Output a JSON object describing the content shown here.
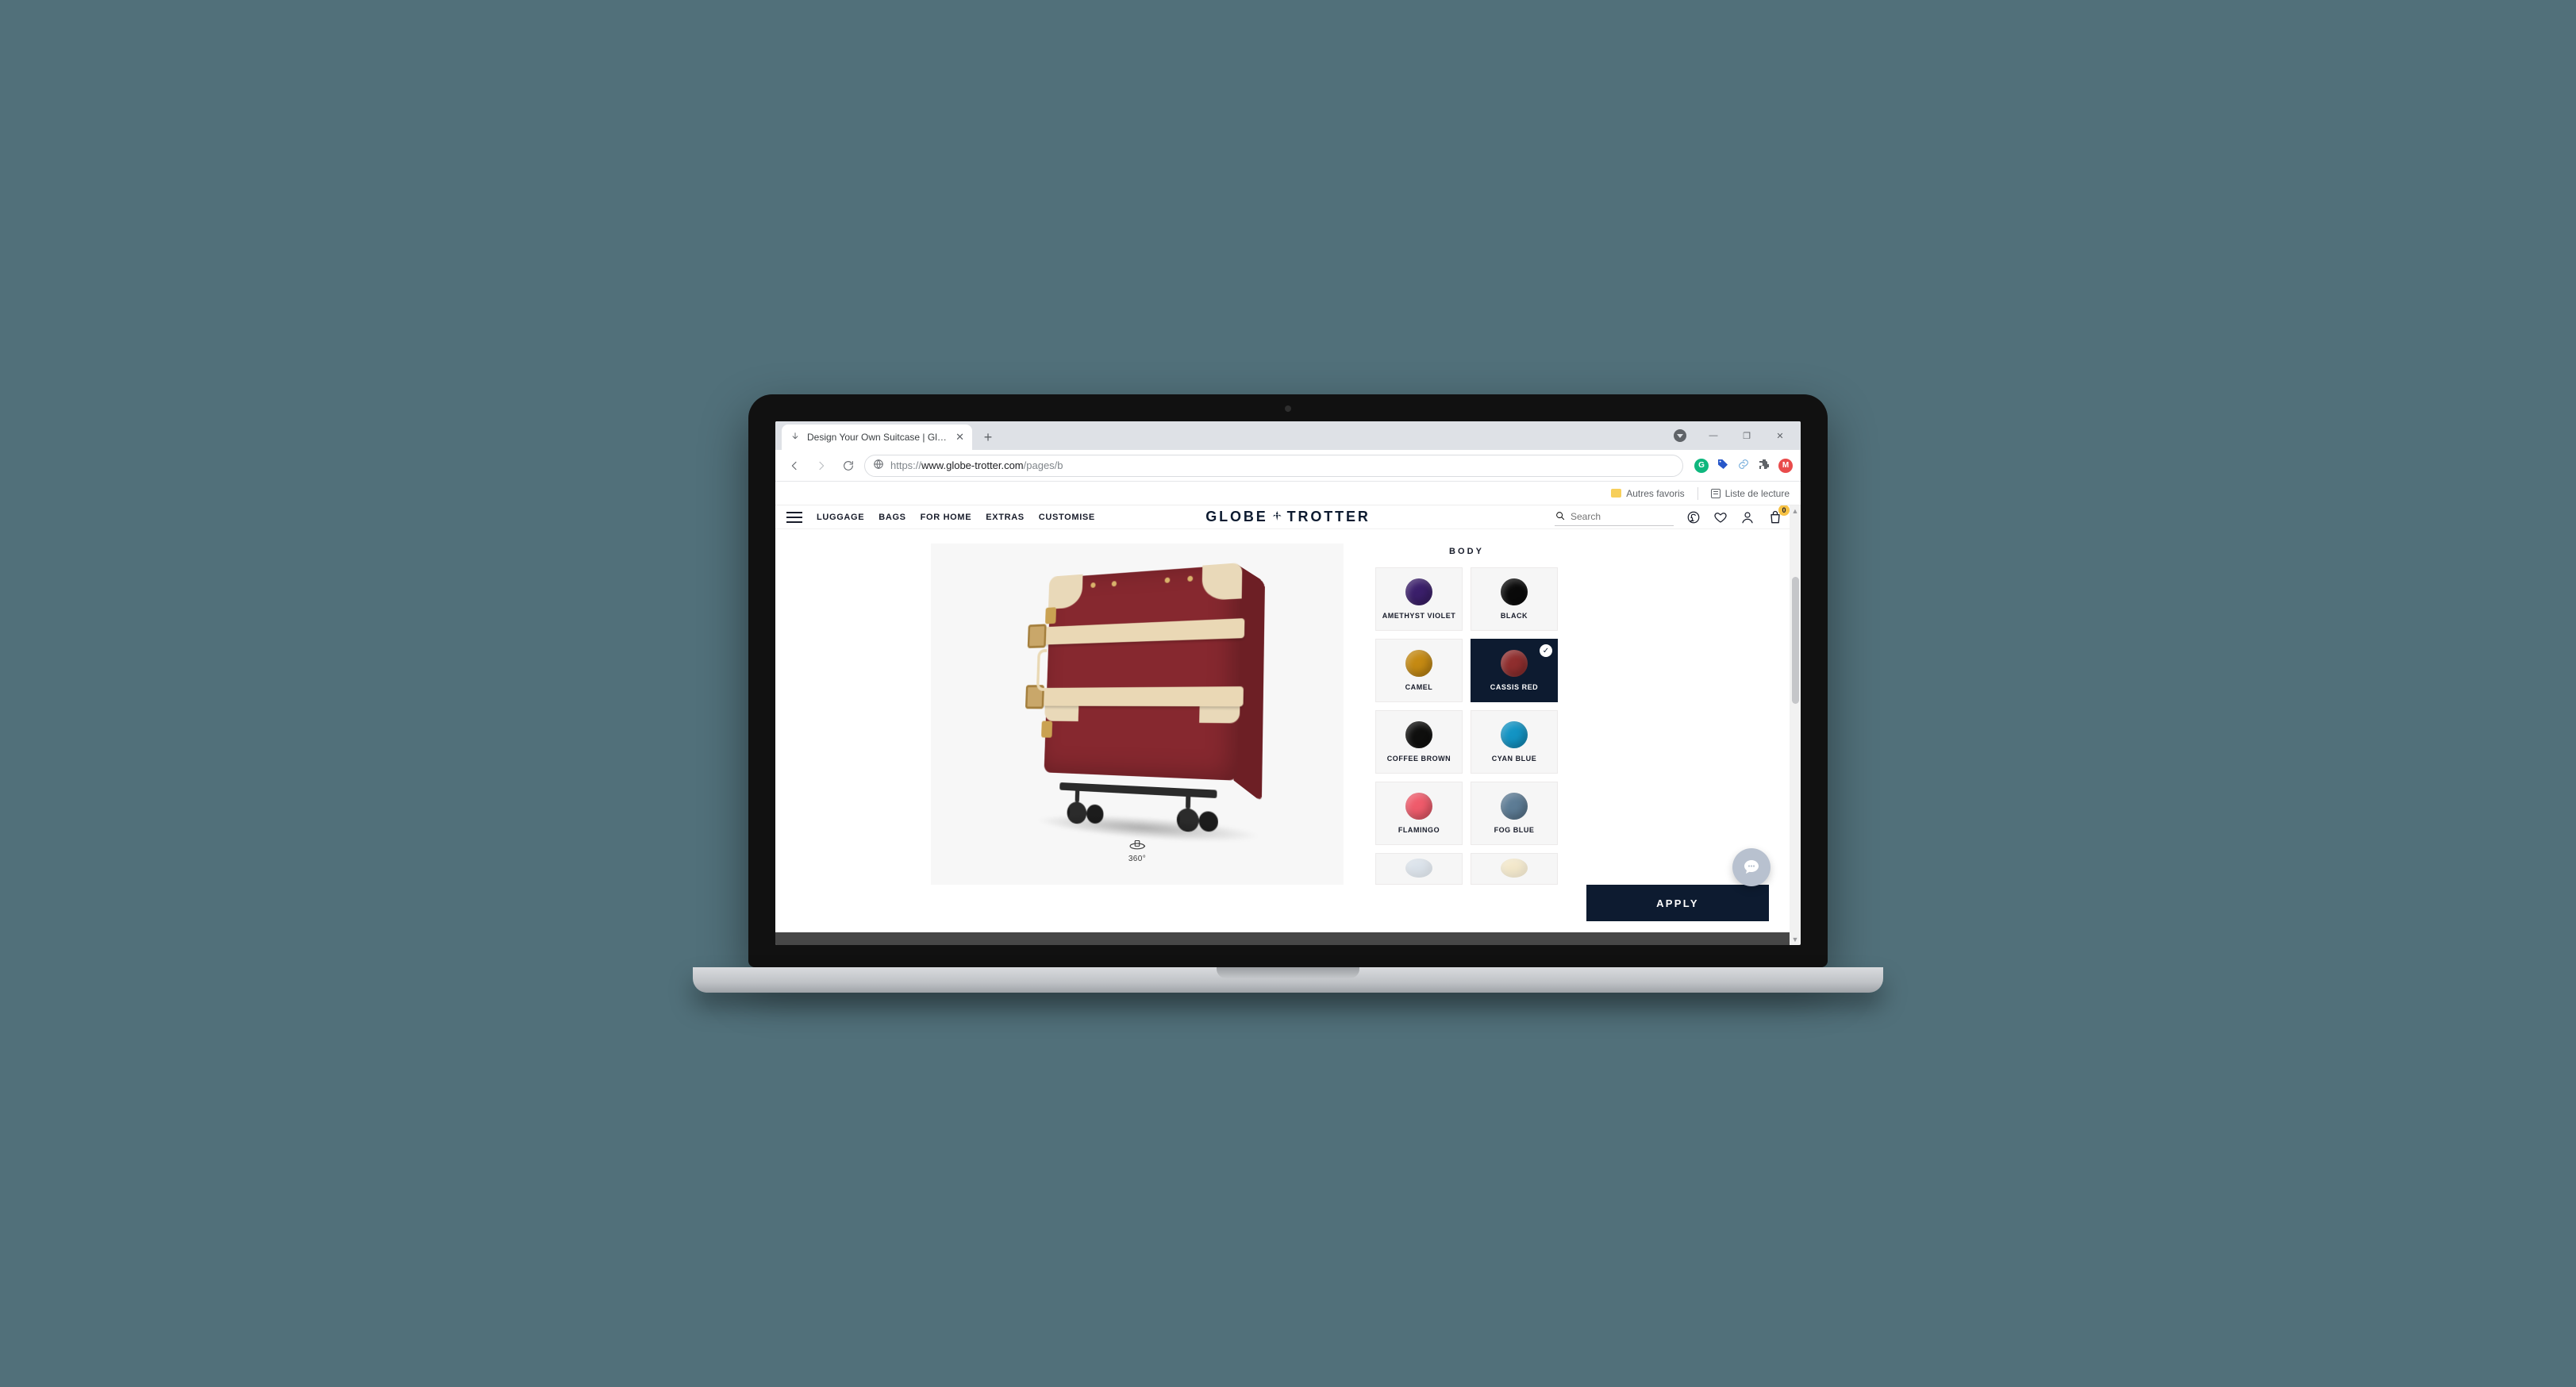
{
  "browser": {
    "tab_title": "Design Your Own Suitcase | Glob…",
    "url_proto": "https://",
    "url_host": "www.globe-trotter.com",
    "url_path": "/pages/b",
    "win": {
      "minimize": "—",
      "maximize": "❐",
      "close": "✕"
    },
    "bookmarks": {
      "other": "Autres favoris",
      "reading_list": "Liste de lecture"
    },
    "ext_g": "G",
    "ext_m": "M"
  },
  "header": {
    "nav": {
      "luggage": "LUGGAGE",
      "bags": "BAGS",
      "for_home": "FOR HOME",
      "extras": "EXTRAS",
      "customise": "CUSTOMISE"
    },
    "brand_left": "GLOBE",
    "brand_right": "TROTTER",
    "search_placeholder": "Search",
    "bag_count": "0"
  },
  "preview": {
    "rotate_label": "360°"
  },
  "options": {
    "section_title": "BODY",
    "apply_label": "APPLY",
    "swatches": [
      {
        "label": "AMETHYST VIOLET",
        "color": "#3b1f6b",
        "selected": false
      },
      {
        "label": "BLACK",
        "color": "#0a0a0a",
        "selected": false
      },
      {
        "label": "CAMEL",
        "color": "#c58a13",
        "selected": false
      },
      {
        "label": "CASSIS RED",
        "color": "#8f2e2e",
        "selected": true
      },
      {
        "label": "COFFEE BROWN",
        "color": "#0f0f0e",
        "selected": false
      },
      {
        "label": "CYAN BLUE",
        "color": "#1394c4",
        "selected": false
      },
      {
        "label": "FLAMINGO",
        "color": "#ef5b6b",
        "selected": false
      },
      {
        "label": "FOG BLUE",
        "color": "#5d7c95",
        "selected": false
      }
    ],
    "peek": [
      {
        "color": "#a9bfd6"
      },
      {
        "color": "#f1d07a"
      }
    ]
  }
}
